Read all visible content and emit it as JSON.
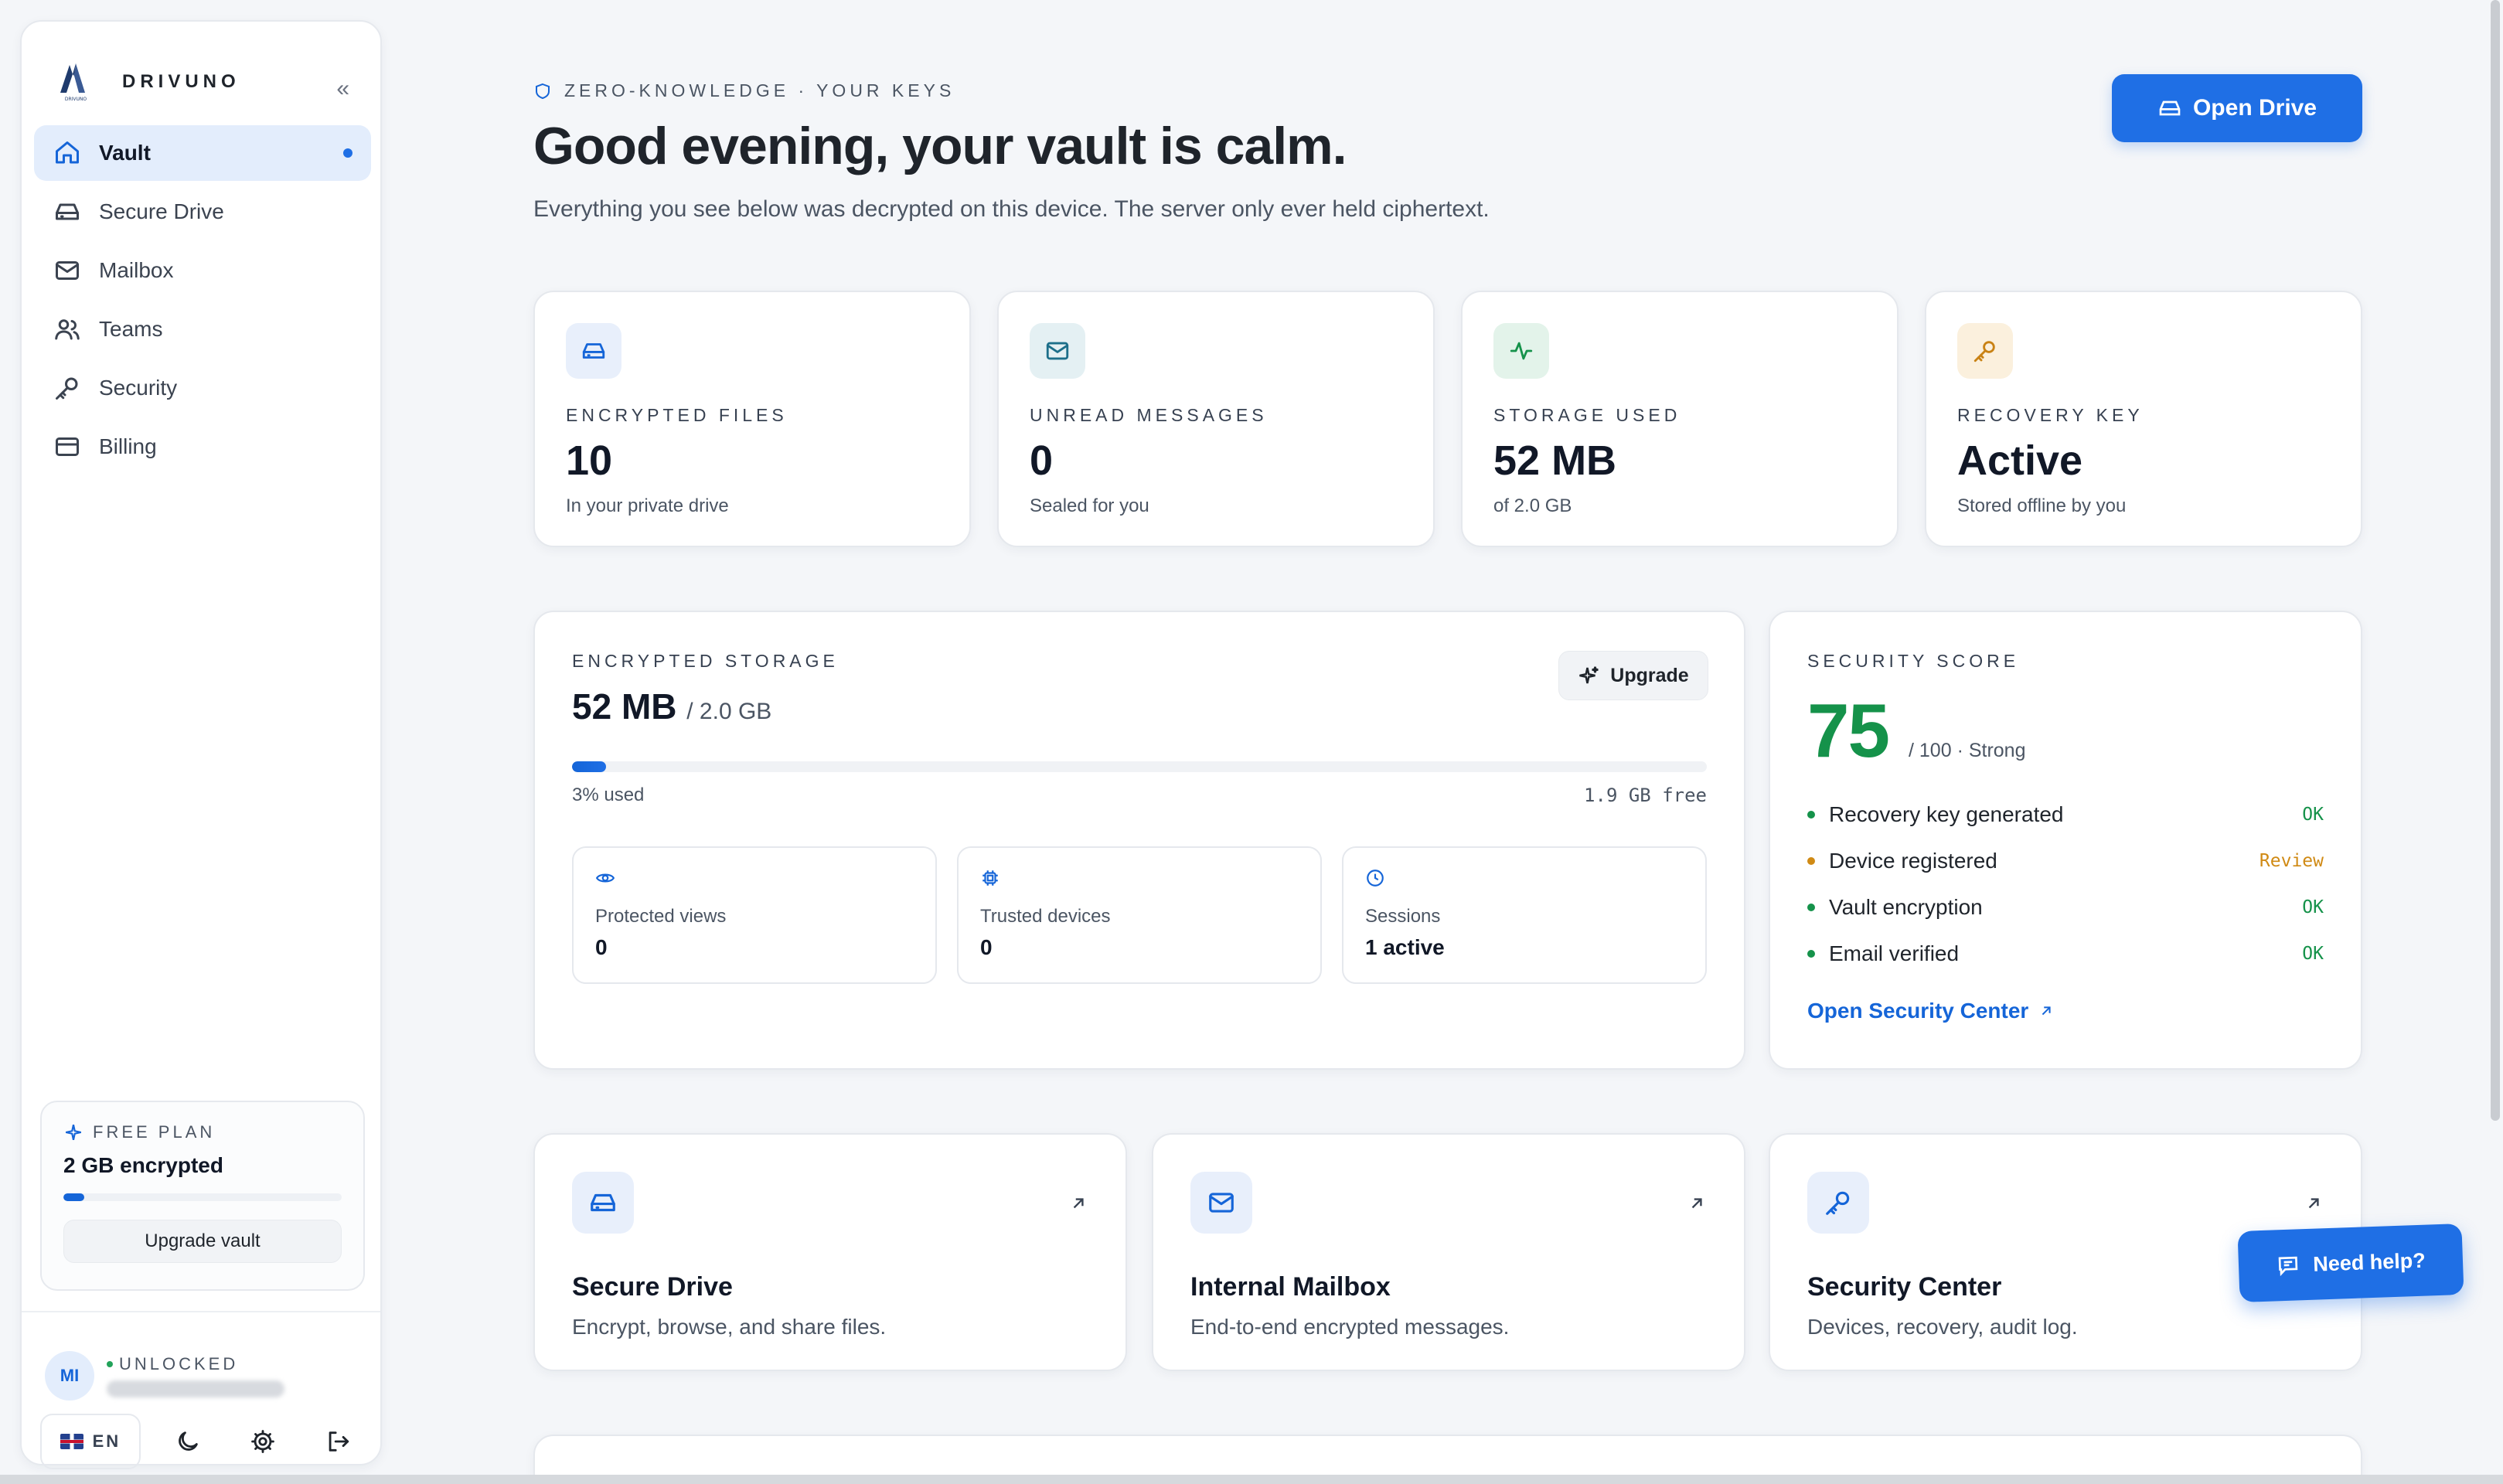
{
  "brand": {
    "name": "DRIVUNO",
    "logo_caption": "DRIVUNO"
  },
  "sidebar": {
    "collapse_glyph": "«",
    "items": [
      {
        "label": "Vault",
        "icon": "home-icon",
        "active": true
      },
      {
        "label": "Secure Drive",
        "icon": "drive-icon"
      },
      {
        "label": "Mailbox",
        "icon": "mail-icon"
      },
      {
        "label": "Teams",
        "icon": "users-icon"
      },
      {
        "label": "Security",
        "icon": "key-icon"
      },
      {
        "label": "Billing",
        "icon": "card-icon"
      }
    ],
    "plan": {
      "label": "FREE PLAN",
      "title": "2 GB encrypted",
      "button": "Upgrade vault",
      "usage_fraction": 0.03
    },
    "user": {
      "initials": "MI",
      "status": "UNLOCKED"
    },
    "lang": "EN"
  },
  "header": {
    "eyebrow": "ZERO-KNOWLEDGE · YOUR KEYS",
    "title": "Good evening, your vault is calm.",
    "subtitle": "Everything you see below was decrypted on this device. The server only ever held ciphertext.",
    "primary_button": "Open Drive"
  },
  "stats": [
    {
      "label": "ENCRYPTED FILES",
      "value": "10",
      "sub": "In your private drive",
      "icon": "drive-icon",
      "accent": "#1565d8",
      "bg": "#e8effb"
    },
    {
      "label": "UNREAD MESSAGES",
      "value": "0",
      "sub": "Sealed for you",
      "icon": "mail-icon",
      "accent": "#1d6f8a",
      "bg": "#e4f0f3"
    },
    {
      "label": "STORAGE USED",
      "value": "52 MB",
      "sub": "of 2.0 GB",
      "icon": "activity-icon",
      "accent": "#15924a",
      "bg": "#e3f3ea"
    },
    {
      "label": "RECOVERY KEY",
      "value": "Active",
      "sub": "Stored offline by you",
      "icon": "key-icon",
      "accent": "#c98214",
      "bg": "#fbf0dd"
    }
  ],
  "storage": {
    "label": "ENCRYPTED STORAGE",
    "value": "52 MB",
    "total": "/ 2.0 GB",
    "upgrade": "Upgrade",
    "used_fraction": 0.03,
    "used_text": "3% used",
    "free_text": "1.9 GB free",
    "minis": [
      {
        "label": "Protected views",
        "value": "0",
        "icon": "eye-icon"
      },
      {
        "label": "Trusted devices",
        "value": "0",
        "icon": "chip-icon"
      },
      {
        "label": "Sessions",
        "value": "1 active",
        "icon": "clock-icon"
      }
    ]
  },
  "security_score": {
    "label": "SECURITY SCORE",
    "value": "75",
    "of": "/ 100 · Strong",
    "checks": [
      {
        "label": "Recovery key generated",
        "status": "OK",
        "color": "#15924a"
      },
      {
        "label": "Device registered",
        "status": "Review",
        "color": "#d08a14"
      },
      {
        "label": "Vault encryption",
        "status": "OK",
        "color": "#15924a"
      },
      {
        "label": "Email verified",
        "status": "OK",
        "color": "#15924a"
      }
    ],
    "link": "Open Security Center"
  },
  "quick_links": [
    {
      "title": "Secure Drive",
      "desc": "Encrypt, browse, and share files.",
      "icon": "drive-icon"
    },
    {
      "title": "Internal Mailbox",
      "desc": "End-to-end encrypted messages.",
      "icon": "mail-icon"
    },
    {
      "title": "Security Center",
      "desc": "Devices, recovery, audit log.",
      "icon": "key-icon"
    }
  ],
  "help_button": "Need help?"
}
